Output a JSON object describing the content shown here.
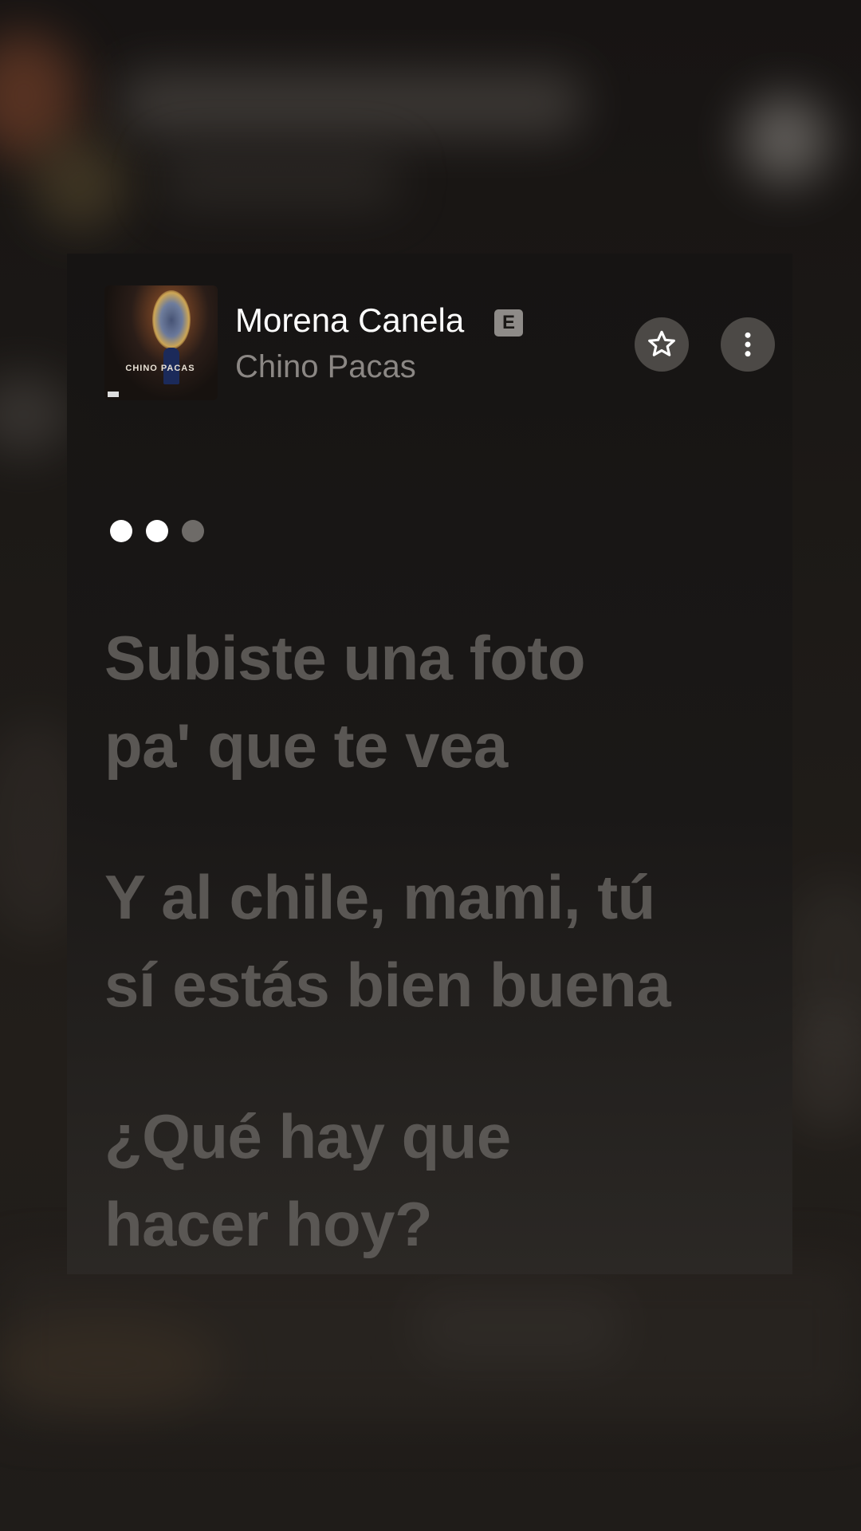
{
  "track": {
    "title": "Morena Canela",
    "explicit_badge": "E",
    "artist": "Chino Pacas",
    "artwork_label": "Album artwork",
    "artwork_text": "CHINO PACAS"
  },
  "actions": {
    "favorite_icon": "star-icon",
    "more_icon": "more-vertical-icon"
  },
  "progress_dots": {
    "total": 3,
    "active": 2
  },
  "lyrics": [
    [
      "Subiste una foto",
      "pa' que te vea"
    ],
    [
      "Y al chile, mami, tú",
      "sí estás bien buena"
    ],
    [
      "¿Qué hay que",
      "hacer hoy?"
    ]
  ],
  "colors": {
    "background": "#141211",
    "title": "#ffffff",
    "artist": "#8b8784",
    "lyric_inactive": "#5a5754",
    "explicit_badge_bg": "#8e8b88"
  }
}
